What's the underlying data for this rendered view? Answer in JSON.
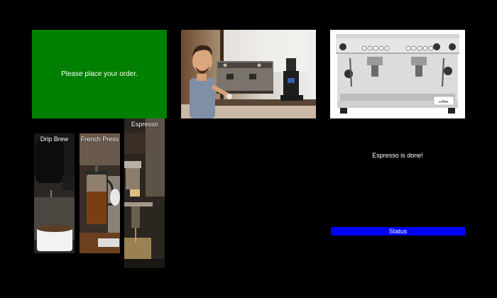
{
  "order_prompt": "Please place your order.",
  "tiles": [
    {
      "label": "Drip Brew"
    },
    {
      "label": "French Press"
    },
    {
      "label": "Espresso"
    }
  ],
  "done_message": "Espresso is done!",
  "status_label": "Status",
  "machine_brand": "coffee",
  "colors": {
    "order_panel": "#008000",
    "status_bar": "#0000ff",
    "background": "#000000"
  }
}
